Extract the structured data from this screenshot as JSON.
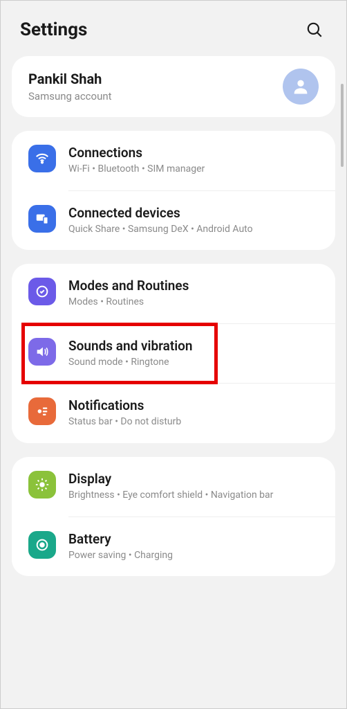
{
  "header": {
    "title": "Settings"
  },
  "account": {
    "name": "Pankil Shah",
    "sub": "Samsung account"
  },
  "groups": [
    {
      "items": [
        {
          "id": "connections",
          "title": "Connections",
          "sub": "Wi-Fi  •  Bluetooth  •  SIM manager",
          "color": "bg-blue"
        },
        {
          "id": "connected-devices",
          "title": "Connected devices",
          "sub": "Quick Share  •  Samsung DeX  •  Android Auto",
          "color": "bg-blue"
        }
      ]
    },
    {
      "items": [
        {
          "id": "modes",
          "title": "Modes and Routines",
          "sub": "Modes  •  Routines",
          "color": "bg-purple"
        },
        {
          "id": "sounds",
          "title": "Sounds and vibration",
          "sub": "Sound mode  •  Ringtone",
          "color": "bg-purple2",
          "highlight": true
        },
        {
          "id": "notifications",
          "title": "Notifications",
          "sub": "Status bar  •  Do not disturb",
          "color": "bg-orange"
        }
      ]
    },
    {
      "items": [
        {
          "id": "display",
          "title": "Display",
          "sub": "Brightness  •  Eye comfort shield  •  Navigation bar",
          "color": "bg-green"
        },
        {
          "id": "battery",
          "title": "Battery",
          "sub": "Power saving  •  Charging",
          "color": "bg-teal"
        }
      ]
    }
  ]
}
